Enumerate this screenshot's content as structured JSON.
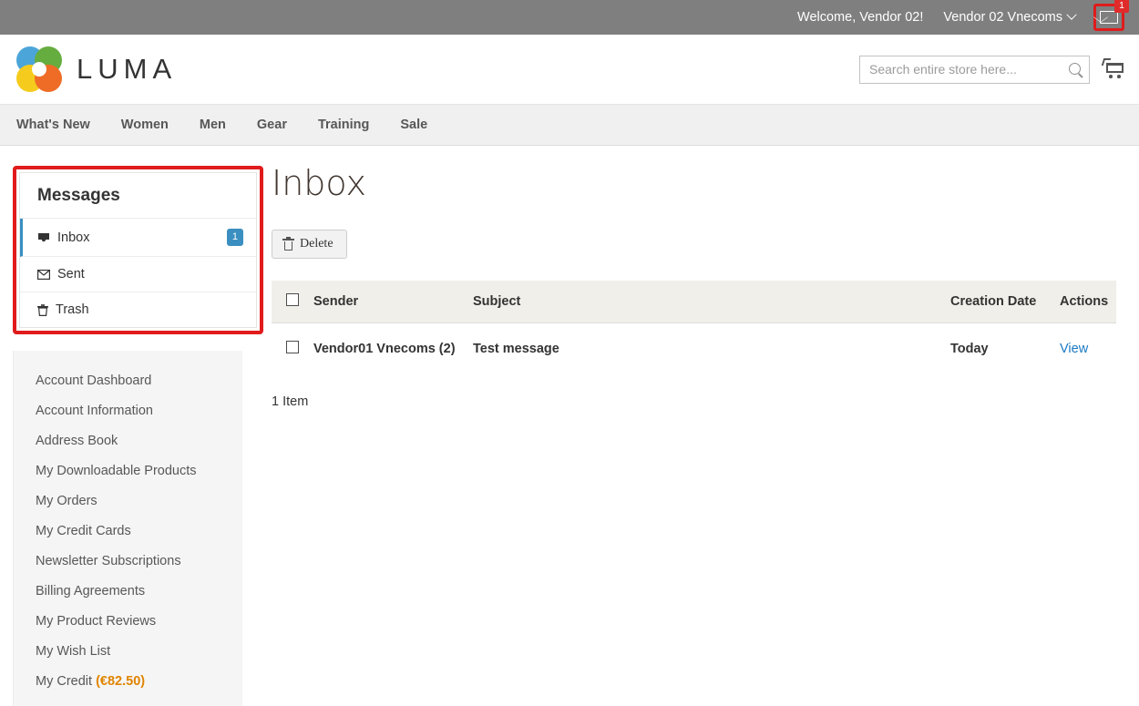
{
  "top_panel": {
    "welcome": "Welcome, Vendor 02!",
    "vendor_switcher": "Vendor 02 Vnecoms",
    "chevron_icon": "chevron-down-icon",
    "message_icon": "envelope-icon",
    "message_badge": "1"
  },
  "header": {
    "logo_text": "LUMA",
    "logo_icon": "luma-logo-icon",
    "search": {
      "placeholder": "Search entire store here...",
      "value": "",
      "icon": "search-icon"
    },
    "cart_icon": "shopping-cart-icon"
  },
  "nav": {
    "items": [
      {
        "label": "What's New"
      },
      {
        "label": "Women"
      },
      {
        "label": "Men"
      },
      {
        "label": "Gear"
      },
      {
        "label": "Training"
      },
      {
        "label": "Sale"
      }
    ]
  },
  "sidebar": {
    "messages_block": {
      "title": "Messages",
      "items": [
        {
          "label": "Inbox",
          "icon": "inbox-tray-icon",
          "badge": "1",
          "active": true
        },
        {
          "label": "Sent",
          "icon": "envelope-icon",
          "badge": "",
          "active": false
        },
        {
          "label": "Trash",
          "icon": "trash-icon",
          "badge": "",
          "active": false
        }
      ]
    },
    "account_nav": {
      "items": [
        {
          "label": "Account Dashboard"
        },
        {
          "label": "Account Information"
        },
        {
          "label": "Address Book"
        },
        {
          "label": "My Downloadable Products"
        },
        {
          "label": "My Orders"
        },
        {
          "label": "My Credit Cards"
        },
        {
          "label": "Newsletter Subscriptions"
        },
        {
          "label": "Billing Agreements"
        },
        {
          "label": "My Product Reviews"
        },
        {
          "label": "My Wish List"
        },
        {
          "label": "My Credit ",
          "amount": "(€82.50)"
        }
      ]
    }
  },
  "main": {
    "title": "Inbox",
    "delete_button": {
      "label": "Delete",
      "icon": "trash-icon"
    },
    "table": {
      "columns": [
        "Sender",
        "Subject",
        "Creation Date",
        "Actions"
      ],
      "rows": [
        {
          "sender": "Vendor01 Vnecoms (2)",
          "subject": "Test message",
          "creation_date": "Today",
          "action": "View"
        }
      ]
    },
    "count_text": "1 Item"
  },
  "colors": {
    "top_bar": "#7f7f7f",
    "highlight_red": "#e01b1b",
    "accent_blue": "#3a8fc0",
    "link_blue": "#1979c3",
    "credit_orange": "#e08400"
  }
}
